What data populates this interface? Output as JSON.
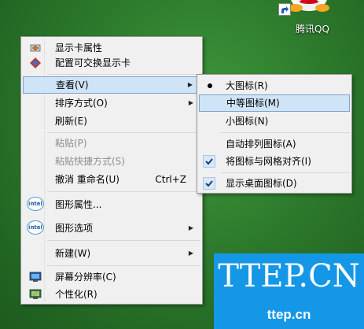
{
  "desktop": {
    "icon_label": "腾讯QQ",
    "background_color": "#2d7a2c"
  },
  "menu": {
    "items": [
      {
        "label": "显示卡属性",
        "icon": "nvidia-card-icon"
      },
      {
        "label": "配置可交换显示卡",
        "icon": "switchable-graphics-icon"
      },
      {
        "label": "查看(V)",
        "submenu": true,
        "highlighted": true
      },
      {
        "label": "排序方式(O)",
        "submenu": true
      },
      {
        "label": "刷新(E)"
      },
      {
        "label": "粘贴(P)",
        "disabled": true
      },
      {
        "label": "粘贴快捷方式(S)",
        "disabled": true
      },
      {
        "label": "撤消 重命名(U)",
        "accelerator": "Ctrl+Z"
      },
      {
        "label": "图形属性...",
        "icon": "intel-icon"
      },
      {
        "label": "图形选项",
        "icon": "intel-icon",
        "submenu": true
      },
      {
        "label": "新建(W)",
        "submenu": true
      },
      {
        "label": "屏幕分辨率(C)",
        "icon": "screen-resolution-icon"
      },
      {
        "label": "个性化(R)",
        "icon": "personalize-icon"
      }
    ]
  },
  "submenu": {
    "items": [
      {
        "label": "大图标(R)",
        "marker": "radio"
      },
      {
        "label": "中等图标(M)",
        "highlighted": true
      },
      {
        "label": "小图标(N)"
      },
      {
        "label": "自动排列图标(A)"
      },
      {
        "label": "将图标与网格对齐(I)",
        "marker": "check"
      },
      {
        "label": "显示桌面图标(D)",
        "marker": "check"
      }
    ]
  },
  "intel_logo_text": "intel",
  "watermark": {
    "title": "TTEP.CN",
    "subtitle": "ttep.cn",
    "color": "#1597e8"
  },
  "colors": {
    "highlight_bg": "#cfe4f7",
    "highlight_border": "#7da2ce",
    "check_bg": "#d6e8f9"
  }
}
